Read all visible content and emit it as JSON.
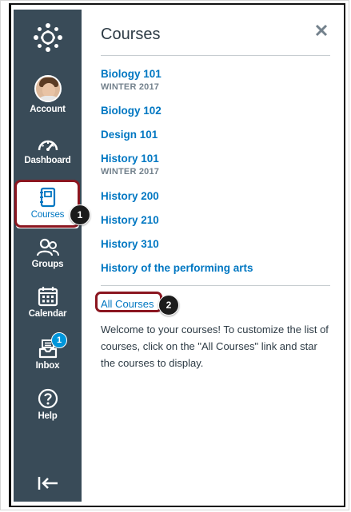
{
  "nav": {
    "items": [
      {
        "key": "account",
        "label": "Account",
        "icon": "user-avatar"
      },
      {
        "key": "dashboard",
        "label": "Dashboard",
        "icon": "speedometer-icon"
      },
      {
        "key": "courses",
        "label": "Courses",
        "icon": "notebook-icon",
        "active": true
      },
      {
        "key": "groups",
        "label": "Groups",
        "icon": "people-icon"
      },
      {
        "key": "calendar",
        "label": "Calendar",
        "icon": "calendar-icon"
      },
      {
        "key": "inbox",
        "label": "Inbox",
        "icon": "inbox-icon",
        "badge": "1"
      },
      {
        "key": "help",
        "label": "Help",
        "icon": "question-circle-icon"
      }
    ],
    "collapse_icon": "collapse-arrow-icon",
    "logo_icon": "canvas-logo"
  },
  "callouts": {
    "one": "1",
    "two": "2"
  },
  "panel": {
    "title": "Courses",
    "close_icon": "close-icon",
    "courses": [
      {
        "name": "Biology 101",
        "term": "WINTER 2017"
      },
      {
        "name": "Biology 102",
        "term": ""
      },
      {
        "name": "Design 101",
        "term": ""
      },
      {
        "name": "History 101",
        "term": "WINTER 2017"
      },
      {
        "name": "History 200",
        "term": ""
      },
      {
        "name": "History 210",
        "term": ""
      },
      {
        "name": "History 310",
        "term": ""
      },
      {
        "name": "History of the performing arts",
        "term": ""
      }
    ],
    "all_courses_label": "All Courses",
    "welcome_text": "Welcome to your courses! To customize the list of courses, click on the \"All Courses\" link and star the courses to display."
  },
  "colors": {
    "nav_bg": "#394b58",
    "link": "#0077c2",
    "highlight": "#8b1620",
    "badge": "#0096db"
  }
}
